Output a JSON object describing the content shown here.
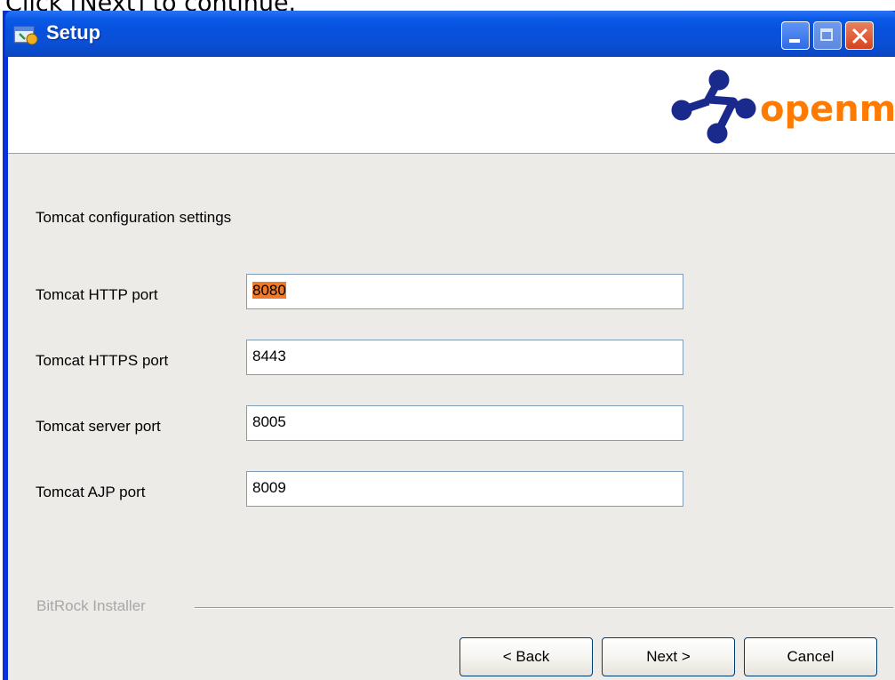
{
  "caption": "Click [Next] to continue.",
  "window": {
    "title": "Setup",
    "icon": "setup-app-icon"
  },
  "header": {
    "logo_text": "openmdx",
    "logo_color": "#1a2a8c",
    "logo_text_color": "#ff7a00"
  },
  "form": {
    "heading": "Tomcat configuration settings",
    "fields": [
      {
        "label": "Tomcat HTTP port",
        "value": "8080"
      },
      {
        "label": "Tomcat HTTPS port",
        "value": "8443"
      },
      {
        "label": "Tomcat server port",
        "value": "8005"
      },
      {
        "label": "Tomcat AJP port",
        "value": "8009"
      }
    ]
  },
  "footer": {
    "brand": "BitRock Installer",
    "back_label": "< Back",
    "next_label": "Next >",
    "cancel_label": "Cancel"
  },
  "colors": {
    "titlebar": "#0a5ae8",
    "content_bg": "#ecebe8",
    "selection": "#f07a2c"
  }
}
